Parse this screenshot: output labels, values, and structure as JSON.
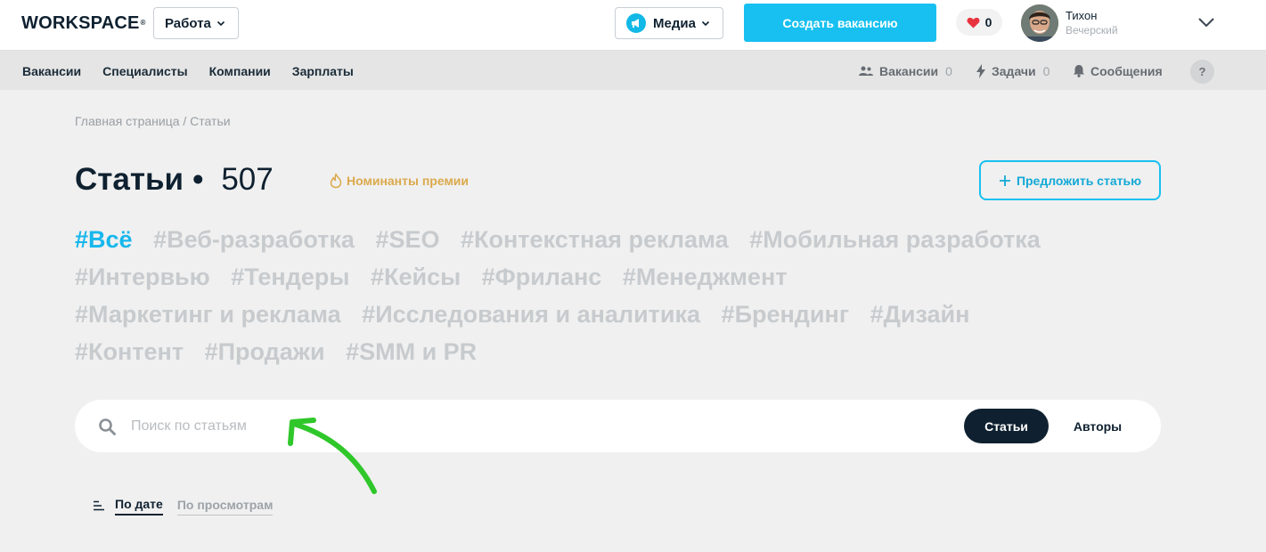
{
  "header": {
    "logo": "WORKSPACE",
    "logo_mark": "®",
    "work_dropdown": "Работа",
    "media_dropdown": "Медиа",
    "create_button": "Создать вакансию",
    "likes_count": "0",
    "user_name": "Тихон",
    "user_surname": "Вечерский"
  },
  "subnav": {
    "links": [
      "Вакансии",
      "Специалисты",
      "Компании",
      "Зарплаты"
    ],
    "vacancies": {
      "label": "Вакансии",
      "count": "0"
    },
    "tasks": {
      "label": "Задачи",
      "count": "0"
    },
    "messages": {
      "label": "Сообщения"
    },
    "help": "?"
  },
  "breadcrumb": "Главная страница / Статьи",
  "page": {
    "title": "Статьи",
    "dot": "•",
    "count": "507",
    "nominees_link": "Номинанты премии",
    "suggest_button": "Предложить статью"
  },
  "tags": [
    "#Всё",
    "#Веб-разработка",
    "#SEO",
    "#Контекстная реклама",
    "#Мобильная разработка",
    "#Интервью",
    "#Тендеры",
    "#Кейсы",
    "#Фриланс",
    "#Менеджмент",
    "#Маркетинг и реклама",
    "#Исследования и аналитика",
    "#Брендинг",
    "#Дизайн",
    "#Контент",
    "#Продажи",
    "#SMM и PR"
  ],
  "search": {
    "placeholder": "Поиск по статьям",
    "value": "",
    "tab_articles": "Статьи",
    "tab_authors": "Авторы"
  },
  "sort": {
    "by_date": "По дате",
    "by_views": "По просмотрам"
  },
  "colors": {
    "accent": "#17c0f0",
    "dark": "#0f2130",
    "tag_inactive": "#c8cbce",
    "nominees": "#dba94c",
    "annotation_arrow": "#2fc72a"
  }
}
